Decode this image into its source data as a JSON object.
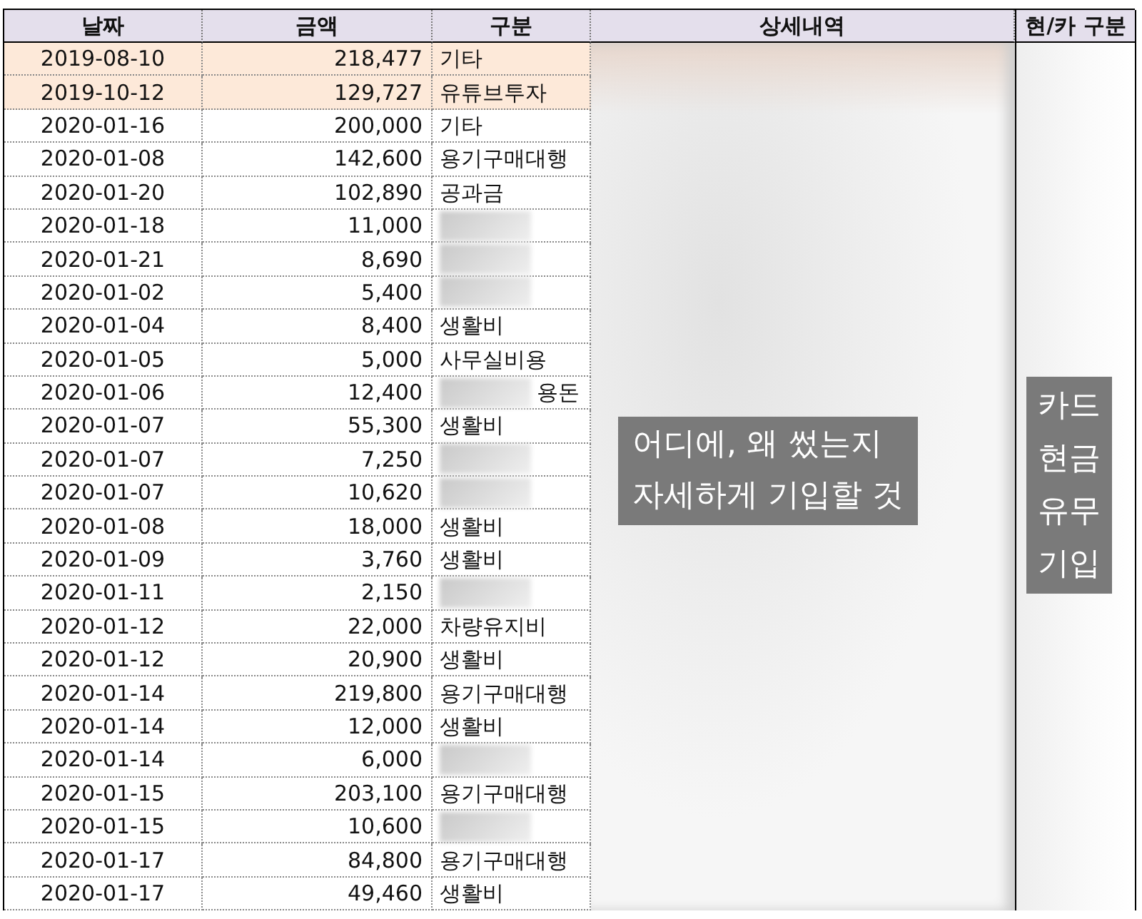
{
  "columns": [
    {
      "label": "날짜"
    },
    {
      "label": "금액"
    },
    {
      "label": "구분"
    },
    {
      "label": "상세내역"
    },
    {
      "label": "현/카 구분"
    }
  ],
  "rows": [
    {
      "date": "2019-08-10",
      "amount": "218,477",
      "category": "기타",
      "highlighted": true,
      "redacted": false
    },
    {
      "date": "2019-10-12",
      "amount": "129,727",
      "category": "유튜브투자",
      "highlighted": true,
      "redacted": false
    },
    {
      "date": "2020-01-16",
      "amount": "200,000",
      "category": "기타",
      "highlighted": false,
      "redacted": false
    },
    {
      "date": "2020-01-08",
      "amount": "142,600",
      "category": "용기구매대행",
      "highlighted": false,
      "redacted": false
    },
    {
      "date": "2020-01-20",
      "amount": "102,890",
      "category": "공과금",
      "highlighted": false,
      "redacted": false
    },
    {
      "date": "2020-01-18",
      "amount": "11,000",
      "highlighted": false,
      "redacted": true
    },
    {
      "date": "2020-01-21",
      "amount": "8,690",
      "highlighted": false,
      "redacted": true
    },
    {
      "date": "2020-01-02",
      "amount": "5,400",
      "highlighted": false,
      "redacted": true
    },
    {
      "date": "2020-01-04",
      "amount": "8,400",
      "category": "생활비",
      "highlighted": false,
      "redacted": false
    },
    {
      "date": "2020-01-05",
      "amount": "5,000",
      "category": "사무실비용",
      "highlighted": false,
      "redacted": false
    },
    {
      "date": "2020-01-06",
      "amount": "12,400",
      "category": "용돈",
      "highlighted": false,
      "redacted": true
    },
    {
      "date": "2020-01-07",
      "amount": "55,300",
      "category": "생활비",
      "highlighted": false,
      "redacted": false
    },
    {
      "date": "2020-01-07",
      "amount": "7,250",
      "highlighted": false,
      "redacted": true
    },
    {
      "date": "2020-01-07",
      "amount": "10,620",
      "highlighted": false,
      "redacted": true
    },
    {
      "date": "2020-01-08",
      "amount": "18,000",
      "category": "생활비",
      "highlighted": false,
      "redacted": false
    },
    {
      "date": "2020-01-09",
      "amount": "3,760",
      "category": "생활비",
      "highlighted": false,
      "redacted": false
    },
    {
      "date": "2020-01-11",
      "amount": "2,150",
      "highlighted": false,
      "redacted": true
    },
    {
      "date": "2020-01-12",
      "amount": "22,000",
      "category": "차량유지비",
      "highlighted": false,
      "redacted": false
    },
    {
      "date": "2020-01-12",
      "amount": "20,900",
      "category": "생활비",
      "highlighted": false,
      "redacted": false
    },
    {
      "date": "2020-01-14",
      "amount": "219,800",
      "category": "용기구매대행",
      "highlighted": false,
      "redacted": false
    },
    {
      "date": "2020-01-14",
      "amount": "12,000",
      "category": "생활비",
      "highlighted": false,
      "redacted": false
    },
    {
      "date": "2020-01-14",
      "amount": "6,000",
      "highlighted": false,
      "redacted": true
    },
    {
      "date": "2020-01-15",
      "amount": "203,100",
      "category": "용기구매대행",
      "highlighted": false,
      "redacted": false
    },
    {
      "date": "2020-01-15",
      "amount": "10,600",
      "highlighted": false,
      "redacted": true
    },
    {
      "date": "2020-01-17",
      "amount": "84,800",
      "category": "용기구매대행",
      "highlighted": false,
      "redacted": false
    },
    {
      "date": "2020-01-17",
      "amount": "49,460",
      "category": "생활비",
      "highlighted": false,
      "redacted": false
    }
  ],
  "detail_note": {
    "lines": [
      "어디에, 왜 썼는지",
      "자세하게 기입할 것"
    ]
  },
  "type_note": {
    "lines": [
      "카드",
      "현금",
      "유무",
      "기입"
    ]
  }
}
